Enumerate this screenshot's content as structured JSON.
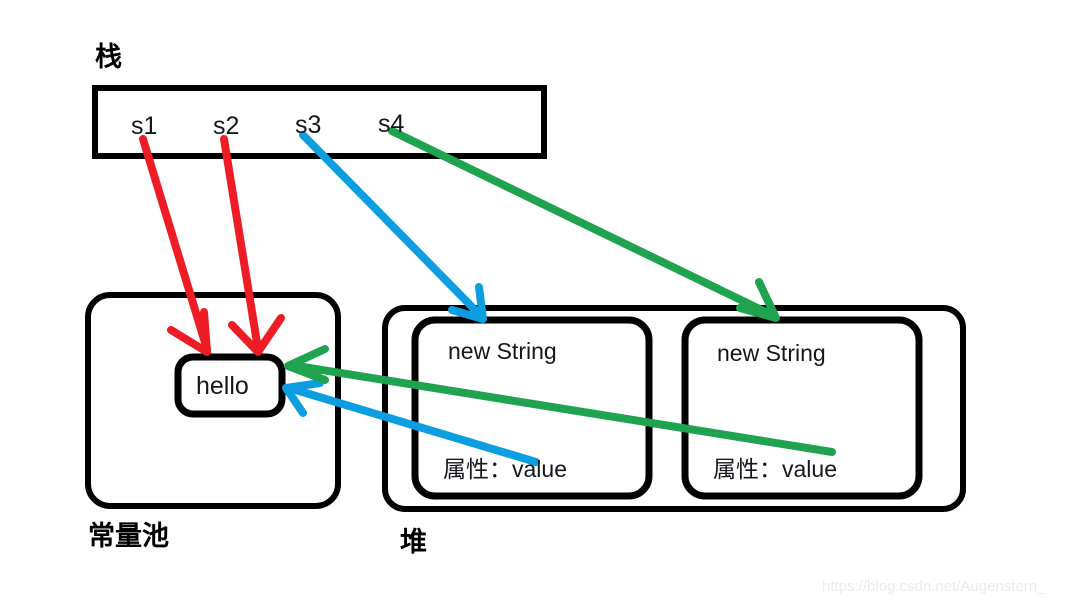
{
  "diagram": {
    "title_stack": "栈",
    "title_pool": "常量池",
    "title_heap": "堆",
    "colors": {
      "red": "#ee1c25",
      "blue": "#0c9ee0",
      "green": "#1fa34e",
      "stroke": "#000000",
      "text": "#14171c",
      "background": "#ffffff",
      "watermark": "#ebebeb"
    }
  },
  "stack": {
    "label": "栈",
    "variables": [
      {
        "name": "s1",
        "arrow_color": "#ee1c25",
        "target": "hello"
      },
      {
        "name": "s2",
        "arrow_color": "#ee1c25",
        "target": "hello"
      },
      {
        "name": "s3",
        "arrow_color": "#0c9ee0",
        "target": "new-string-1"
      },
      {
        "name": "s4",
        "arrow_color": "#1fa34e",
        "target": "new-string-2"
      }
    ]
  },
  "constant_pool": {
    "label": "常量池",
    "entries": [
      {
        "id": "hello",
        "text": "hello"
      }
    ]
  },
  "heap": {
    "label": "堆",
    "objects": [
      {
        "id": "new-string-1",
        "title": "new String",
        "field": "属性：value",
        "field_arrow_color": "#0c9ee0",
        "field_target": "hello"
      },
      {
        "id": "new-string-2",
        "title": "new String",
        "field": "属性：value",
        "field_arrow_color": "#1fa34e",
        "field_target": "hello"
      }
    ]
  },
  "watermark": {
    "text": "https://blog.csdn.net/Augenstern_"
  }
}
